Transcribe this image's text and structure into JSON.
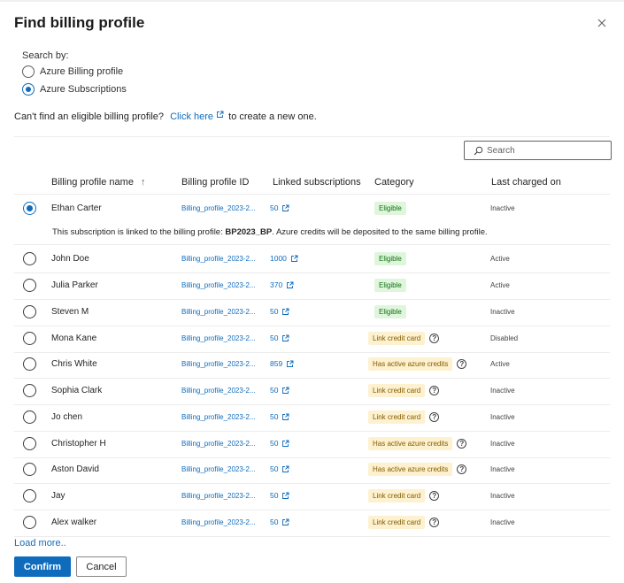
{
  "dialog": {
    "title": "Find billing profile",
    "close_icon": "close-icon"
  },
  "search_by": {
    "label": "Search by:",
    "options": [
      {
        "label": "Azure Billing profile",
        "selected": false
      },
      {
        "label": "Azure Subscriptions",
        "selected": true
      }
    ]
  },
  "cant_find": {
    "text_before": "Can't find an eligible billing profile?",
    "link": "Click here",
    "text_after": "to create a new one."
  },
  "search": {
    "placeholder": "Search",
    "icon": "search-icon"
  },
  "table": {
    "columns": [
      "Billing profile name",
      "Billing profile ID",
      "Linked subscriptions",
      "Category",
      "Last charged on"
    ],
    "sort_icon": "arrow-up-icon",
    "rows": [
      {
        "name": "Ethan Carter",
        "id": "Billing_profile_2023-2...",
        "linked": "50",
        "category": "Eligible",
        "category_style": "green",
        "help": false,
        "status": "Inactive",
        "selected": true
      },
      {
        "name": "John Doe",
        "id": "Billing_profile_2023-2...",
        "linked": "1000",
        "category": "Eligible",
        "category_style": "green",
        "help": false,
        "status": "Active",
        "selected": false
      },
      {
        "name": "Julia Parker",
        "id": "Billing_profile_2023-2...",
        "linked": "370",
        "category": "Eligible",
        "category_style": "green",
        "help": false,
        "status": "Active",
        "selected": false
      },
      {
        "name": "Steven M",
        "id": "Billing_profile_2023-2...",
        "linked": "50",
        "category": "Eligible",
        "category_style": "green",
        "help": false,
        "status": "Inactive",
        "selected": false
      },
      {
        "name": "Mona Kane",
        "id": "Billing_profile_2023-2...",
        "linked": "50",
        "category": "Link credit card",
        "category_style": "yellow",
        "help": true,
        "status": "Disabled",
        "selected": false
      },
      {
        "name": "Chris White",
        "id": "Billing_profile_2023-2...",
        "linked": "859",
        "category": "Has active azure credits",
        "category_style": "yellow",
        "help": true,
        "status": "Active",
        "selected": false
      },
      {
        "name": "Sophia Clark",
        "id": "Billing_profile_2023-2...",
        "linked": "50",
        "category": "Link credit card",
        "category_style": "yellow",
        "help": true,
        "status": "Inactive",
        "selected": false
      },
      {
        "name": "Jo chen",
        "id": "Billing_profile_2023-2...",
        "linked": "50",
        "category": "Link credit card",
        "category_style": "yellow",
        "help": true,
        "status": "Inactive",
        "selected": false
      },
      {
        "name": "Christopher H",
        "id": "Billing_profile_2023-2...",
        "linked": "50",
        "category": "Has active azure credits",
        "category_style": "yellow",
        "help": true,
        "status": "Inactive",
        "selected": false
      },
      {
        "name": "Aston David",
        "id": "Billing_profile_2023-2...",
        "linked": "50",
        "category": "Has active azure credits",
        "category_style": "yellow",
        "help": true,
        "status": "Inactive",
        "selected": false
      },
      {
        "name": "Jay",
        "id": "Billing_profile_2023-2...",
        "linked": "50",
        "category": "Link credit card",
        "category_style": "yellow",
        "help": true,
        "status": "Inactive",
        "selected": false
      },
      {
        "name": "Alex walker",
        "id": "Billing_profile_2023-2...",
        "linked": "50",
        "category": "Link credit card",
        "category_style": "yellow",
        "help": true,
        "status": "Inactive",
        "selected": false
      }
    ],
    "selected_info": {
      "before": "This subscription is linked to the billing profile:",
      "profile": "BP2023_BP",
      "after": ". Azure credits will be deposited to the same billing profile."
    }
  },
  "load_more": "Load more..",
  "buttons": {
    "confirm": "Confirm",
    "cancel": "Cancel"
  },
  "colors": {
    "accent": "#0f6cbd",
    "eligible_bg": "#dff6dd",
    "warning_bg": "#fdf1cf"
  }
}
